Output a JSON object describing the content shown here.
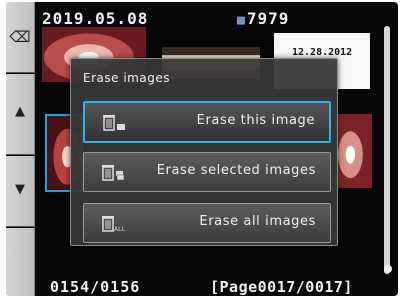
{
  "header": {
    "date": "2019.05.08",
    "patient_id": "7979",
    "patient_icon": "patient-id-icon"
  },
  "thumbnails": {
    "date_card": "12.28.2012"
  },
  "side_buttons": [
    {
      "name": "back",
      "icon": "backspace-icon",
      "glyph": "⌫"
    },
    {
      "name": "up",
      "icon": "arrow-up-icon",
      "glyph": "▲"
    },
    {
      "name": "down",
      "icon": "arrow-down-icon",
      "glyph": "▼"
    },
    {
      "name": "blank",
      "icon": "",
      "glyph": ""
    }
  ],
  "dialog": {
    "title": "Erase images",
    "options": [
      {
        "label": "Erase this image",
        "icon": "trash-single-icon",
        "selected": true
      },
      {
        "label": "Erase selected images",
        "icon": "trash-selected-icon",
        "selected": false
      },
      {
        "label": "Erase all images",
        "icon": "trash-all-icon",
        "selected": false
      }
    ]
  },
  "footer": {
    "counter": "0154/0156",
    "page": "[Page0017/0017]"
  },
  "colors": {
    "accent": "#29b6e8",
    "screen_bg": "#060606",
    "dialog_bg": "#373737"
  }
}
